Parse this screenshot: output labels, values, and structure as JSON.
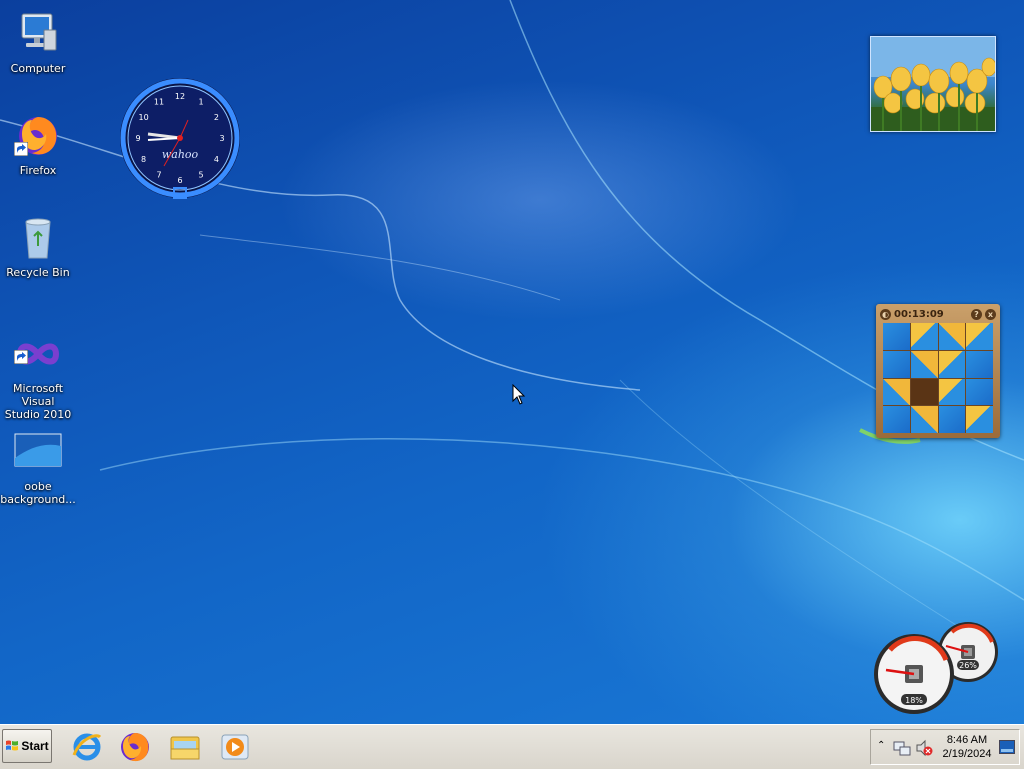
{
  "desktop": {
    "icons": [
      {
        "label": "Computer",
        "icon": "computer-icon"
      },
      {
        "label": "Firefox",
        "icon": "firefox-icon"
      },
      {
        "label": "Recycle Bin",
        "icon": "recycle-bin-icon"
      },
      {
        "label_line1": "Microsoft Visual",
        "label_line2": "Studio 2010",
        "icon": "visual-studio-icon"
      },
      {
        "label_line1": "oobe",
        "label_line2": "background...",
        "icon": "image-file-icon"
      }
    ]
  },
  "gadgets": {
    "clock": {
      "brand": "wahoo",
      "numerals": [
        "12",
        "1",
        "2",
        "3",
        "4",
        "5",
        "6",
        "7",
        "8",
        "9",
        "10",
        "11"
      ]
    },
    "puzzle": {
      "timer": "00:13:09",
      "help": "?",
      "close": "x"
    },
    "meters": {
      "cpu_percent": "18%",
      "memory_percent": "26%"
    }
  },
  "taskbar": {
    "start_label": "Start",
    "pinned": [
      "internet-explorer-icon",
      "firefox-icon",
      "windows-explorer-icon",
      "media-player-icon"
    ],
    "tray": {
      "time": "8:46 AM",
      "date": "2/19/2024"
    }
  },
  "colors": {
    "taskbar": "#d9d5cc",
    "desktop_blue": "#1266c7",
    "tulip_yellow": "#f4c542"
  }
}
